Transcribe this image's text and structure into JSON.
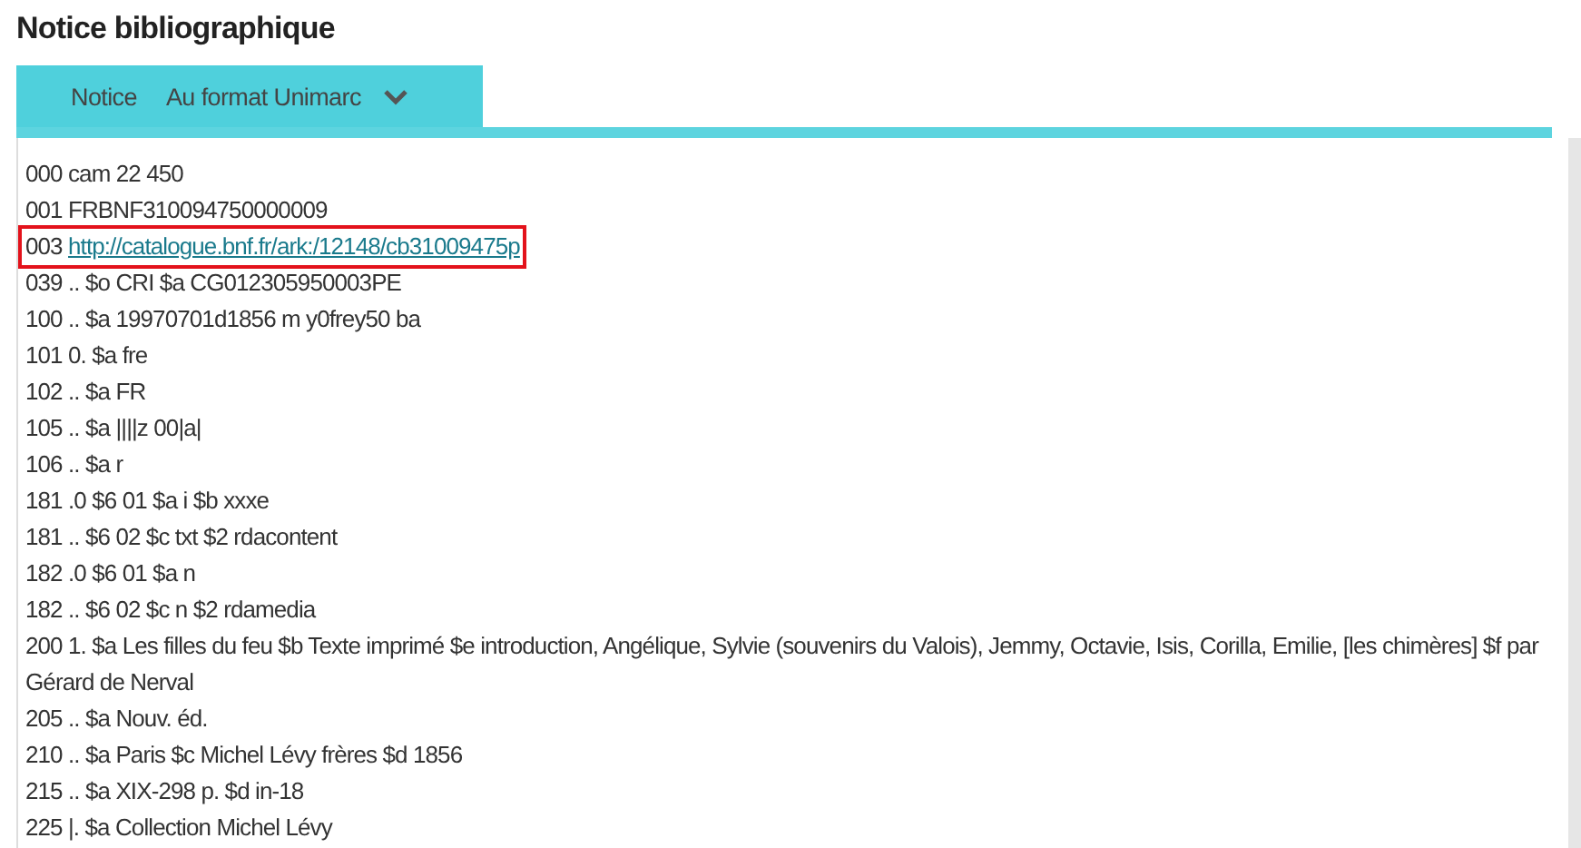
{
  "title": "Notice bibliographique",
  "tabs": [
    {
      "label": "Notice"
    },
    {
      "label": "Au format Unimarc",
      "dropdown": true
    }
  ],
  "record_lines": [
    {
      "text": "000 cam 22 450",
      "highlighted": false
    },
    {
      "text": "001 FRBNF310094750000009",
      "highlighted": false
    },
    {
      "text": "003",
      "link": "http://catalogue.bnf.fr/ark:/12148/cb31009475p",
      "highlighted": true
    },
    {
      "text": "039 .. $o CRI $a CG012305950003PE",
      "highlighted": false
    },
    {
      "text": "100 .. $a 19970701d1856 m y0frey50 ba",
      "highlighted": false
    },
    {
      "text": "101 0. $a fre",
      "highlighted": false
    },
    {
      "text": "102 .. $a FR",
      "highlighted": false
    },
    {
      "text": "105 .. $a ||||z 00|a|",
      "highlighted": false
    },
    {
      "text": "106 .. $a r",
      "highlighted": false
    },
    {
      "text": "181 .0 $6 01 $a i $b xxxe",
      "highlighted": false
    },
    {
      "text": "181 .. $6 02 $c txt $2 rdacontent",
      "highlighted": false
    },
    {
      "text": "182 .0 $6 01 $a n",
      "highlighted": false
    },
    {
      "text": "182 .. $6 02 $c n $2 rdamedia",
      "highlighted": false
    },
    {
      "text": "200 1. $a Les filles du feu $b Texte imprimé $e introduction, Angélique, Sylvie (souvenirs du Valois), Jemmy, Octavie, Isis, Corilla, Emilie, [les chimères] $f par Gérard de Nerval",
      "highlighted": false
    },
    {
      "text": "205 .. $a Nouv. éd.",
      "highlighted": false
    },
    {
      "text": "210 .. $a Paris $c Michel Lévy frères $d 1856",
      "highlighted": false
    },
    {
      "text": "215 .. $a XIX-298 p. $d in-18",
      "highlighted": false
    },
    {
      "text": "225 |. $a Collection Michel Lévy",
      "highlighted": false
    }
  ]
}
